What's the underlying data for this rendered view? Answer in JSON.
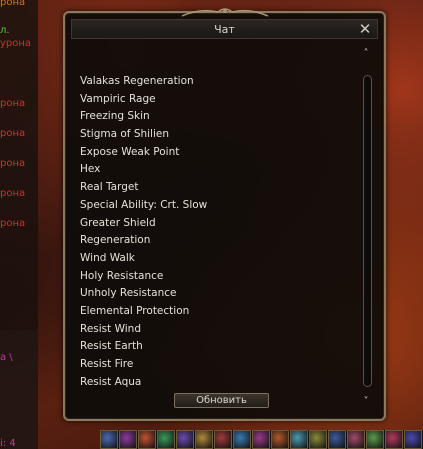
{
  "window": {
    "title": "Чат",
    "close_symbol": "✕",
    "refresh_label": "Обновить",
    "scroll_up_symbol": "˄",
    "scroll_down_symbol": "˅"
  },
  "effects": [
    "Valakas Regeneration",
    "Vampiric Rage",
    "Freezing Skin",
    "Stigma of Shilien",
    "Expose Weak Point",
    "Hex",
    "Real Target",
    "Special Ability: Crt. Slow",
    "Greater Shield",
    "Regeneration",
    "Wind Walk",
    "Holy Resistance",
    "Unholy Resistance",
    "Elemental Protection",
    "Resist Wind",
    "Resist Earth",
    "Resist Fire",
    "Resist Aqua"
  ],
  "left_log": {
    "lines": [
      {
        "text": "рона",
        "color": "orange"
      },
      {
        "text": "л.",
        "color": "green"
      },
      {
        "text": "урона",
        "color": "red"
      },
      {
        "text": "рона",
        "color": "red"
      },
      {
        "text": "рона",
        "color": "red"
      },
      {
        "text": "рона",
        "color": "red"
      },
      {
        "text": "рона",
        "color": "red"
      },
      {
        "text": "рона",
        "color": "red"
      }
    ],
    "bottom_lines": [
      "а \\",
      "і: 4"
    ]
  },
  "colors": {
    "window_border": "#8a7a5e",
    "text": "#e6e2d8",
    "log_red": "#e03030",
    "log_green": "#5fd44a",
    "log_orange": "#e07a1e"
  },
  "skillbar": [
    "skill-slot",
    "skill-slot",
    "skill-slot",
    "skill-slot",
    "skill-slot",
    "skill-slot",
    "skill-slot",
    "skill-slot",
    "skill-slot",
    "skill-slot",
    "skill-slot",
    "skill-slot",
    "skill-slot",
    "skill-slot",
    "skill-slot",
    "skill-slot",
    "skill-slot"
  ]
}
